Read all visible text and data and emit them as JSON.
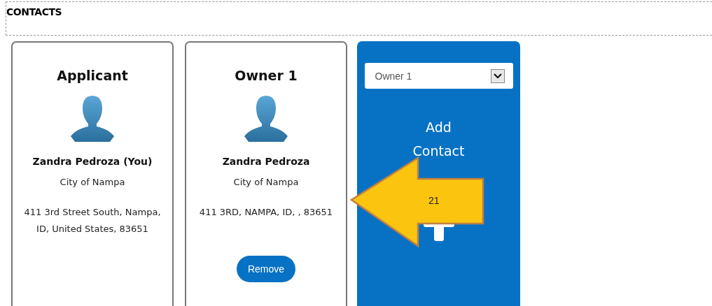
{
  "section": {
    "title": "CONTACTS"
  },
  "contacts": [
    {
      "role": "Applicant",
      "name": "Zandra Pedroza (You)",
      "organization": "City of Nampa",
      "address": "411 3rd Street South, Nampa, ID, United States, 83651"
    },
    {
      "role": "Owner 1",
      "name": "Zandra Pedroza",
      "organization": "City of Nampa",
      "address": "411 3RD, NAMPA, ID, , 83651",
      "action": "Remove"
    }
  ],
  "add_panel": {
    "contact_type": "Owner 1",
    "label": "Add Contact"
  },
  "callout": {
    "label": "21"
  }
}
